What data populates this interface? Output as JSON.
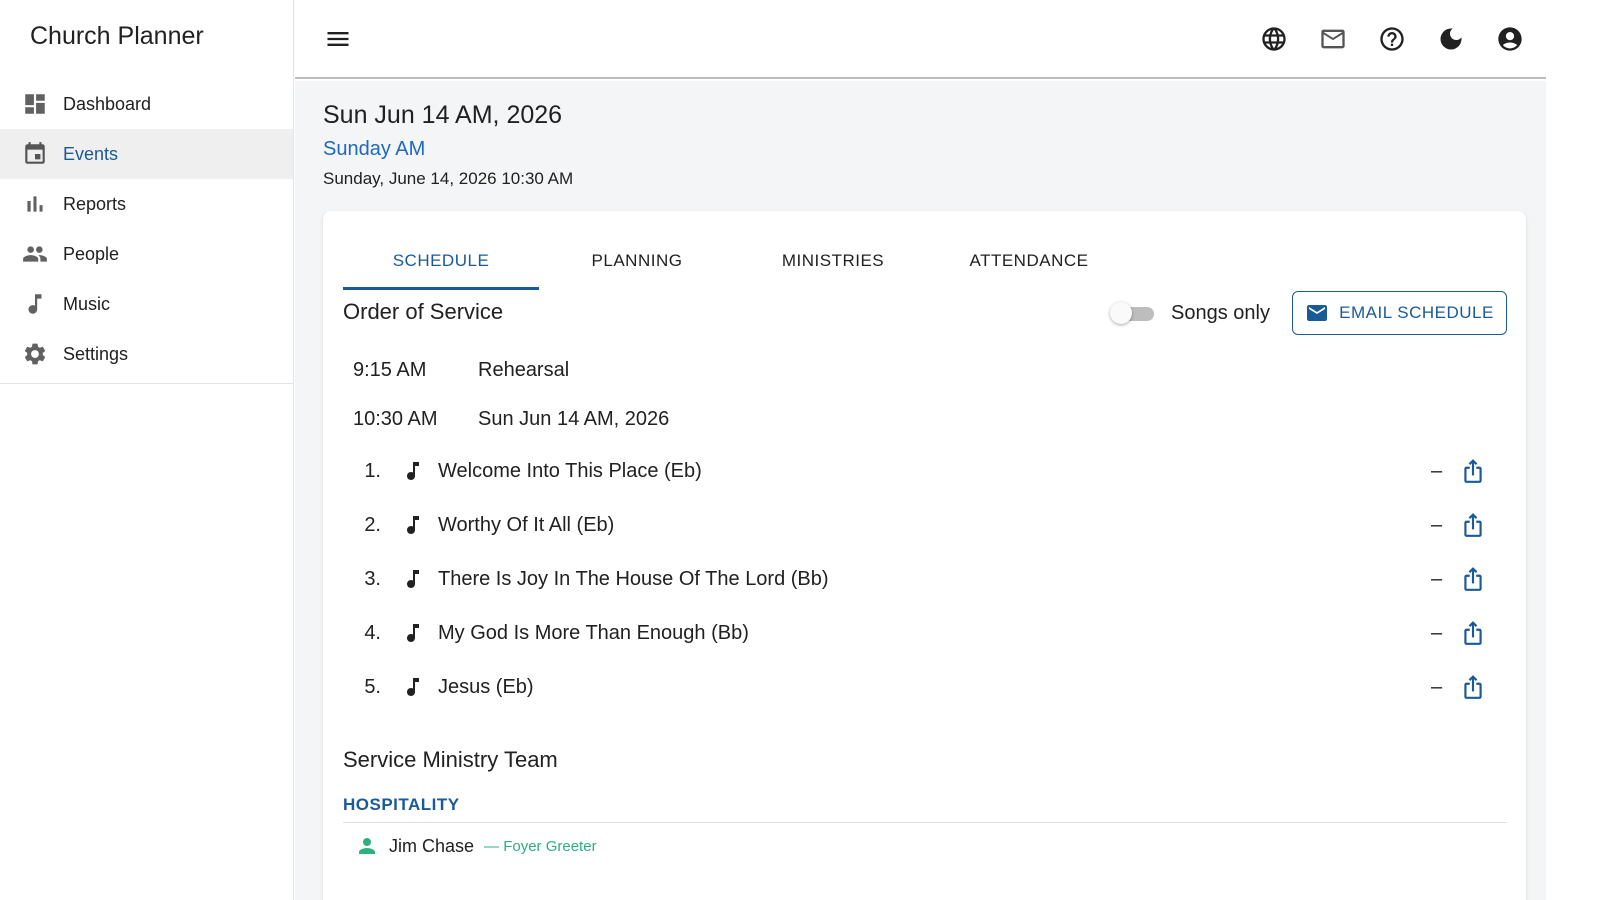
{
  "app": {
    "title": "Church Planner"
  },
  "sidebar": {
    "items": [
      {
        "label": "Dashboard",
        "icon": "dashboard-icon"
      },
      {
        "label": "Events",
        "icon": "calendar-icon",
        "active": true
      },
      {
        "label": "Reports",
        "icon": "bar-chart-icon"
      },
      {
        "label": "People",
        "icon": "people-icon"
      },
      {
        "label": "Music",
        "icon": "music-note-icon"
      },
      {
        "label": "Settings",
        "icon": "gear-icon"
      }
    ]
  },
  "topbar": {
    "icons": [
      "menu-icon",
      "globe-icon",
      "mail-icon",
      "help-icon",
      "dark-mode-icon",
      "account-icon"
    ]
  },
  "event": {
    "title": "Sun Jun 14 AM, 2026",
    "subtitle": "Sunday AM",
    "datetime": "Sunday, June 14, 2026 10:30 AM"
  },
  "tabs": [
    "SCHEDULE",
    "PLANNING",
    "MINISTRIES",
    "ATTENDANCE"
  ],
  "active_tab": "SCHEDULE",
  "order_of_service": {
    "heading": "Order of Service",
    "songs_only_label": "Songs only",
    "songs_only_enabled": false,
    "email_button": "EMAIL SCHEDULE",
    "schedule": [
      {
        "time": "9:15 AM",
        "label": "Rehearsal"
      },
      {
        "time": "10:30 AM",
        "label": "Sun Jun 14 AM, 2026"
      }
    ],
    "songs": [
      {
        "num": "1.",
        "title": "Welcome Into This Place (Eb)"
      },
      {
        "num": "2.",
        "title": "Worthy Of It All (Eb)"
      },
      {
        "num": "3.",
        "title": "There Is Joy In The House Of The Lord (Bb)"
      },
      {
        "num": "4.",
        "title": "My God Is More Than Enough (Bb)"
      },
      {
        "num": "5.",
        "title": "Jesus (Eb)"
      }
    ],
    "song_dash": "–"
  },
  "ministry_team": {
    "heading": "Service Ministry Team",
    "groups": [
      {
        "name": "HOSPITALITY",
        "members": [
          {
            "name": "Jim Chase",
            "role": "— Foyer Greeter"
          }
        ]
      }
    ]
  },
  "colors": {
    "accent": "#1a5a96",
    "link": "#1e68c0",
    "member": "#2bb07e",
    "background": "#f4f5f6"
  }
}
